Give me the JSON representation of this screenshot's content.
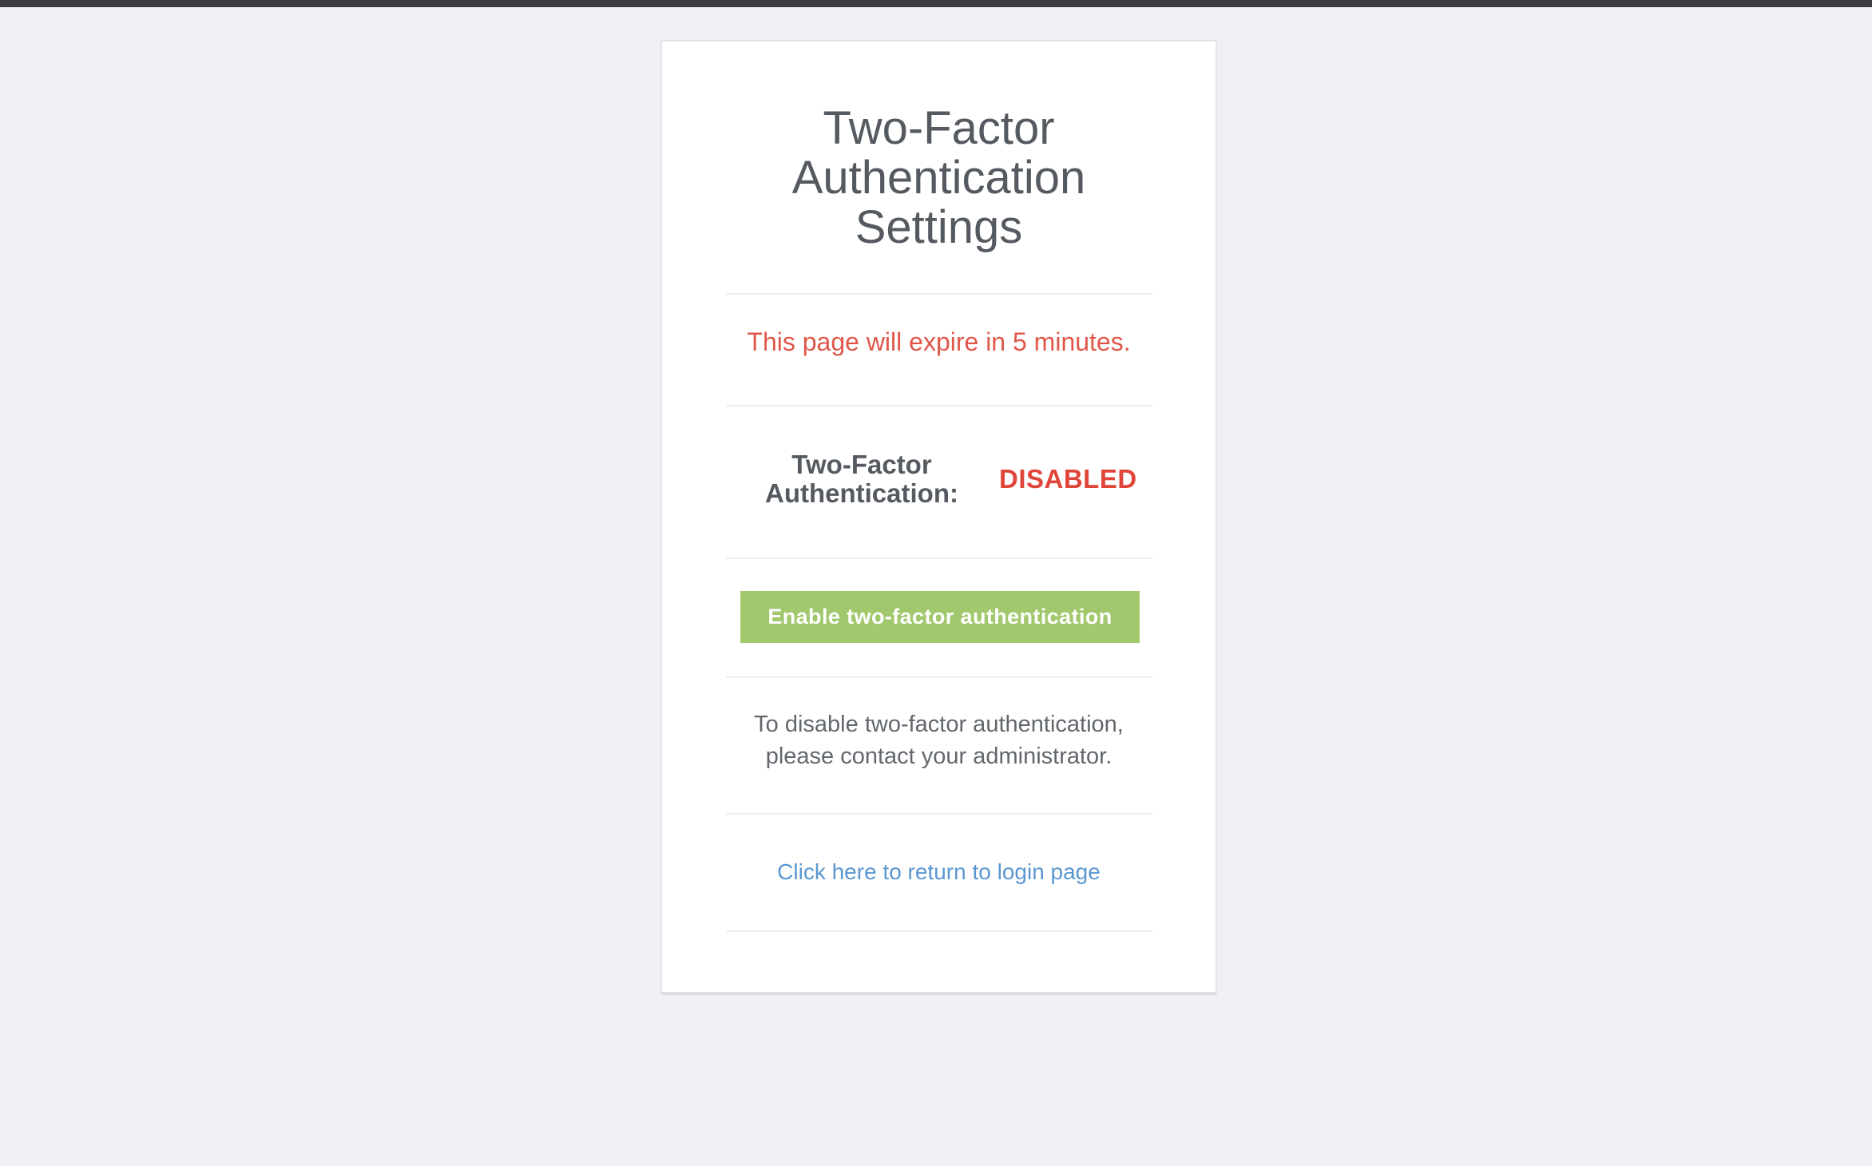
{
  "page": {
    "title_line1": "Two-Factor",
    "title_line2": "Authentication",
    "title_line3": "Settings"
  },
  "expiry": {
    "message": "This page will expire in 5 minutes."
  },
  "status": {
    "label_line1": "Two-Factor",
    "label_line2": "Authentication:",
    "value": "DISABLED"
  },
  "actions": {
    "enable_label": "Enable two-factor authentication"
  },
  "note": {
    "line1": "To disable two-factor authentication,",
    "line2": "please contact your administrator."
  },
  "footer": {
    "return_link": "Click here to return to login page"
  },
  "colors": {
    "background": "#eef0f3",
    "card": "#ffffff",
    "warning": "#e0574a",
    "status_disabled": "#e0453a",
    "button": "#a2c86d",
    "link": "#5b97d1"
  }
}
